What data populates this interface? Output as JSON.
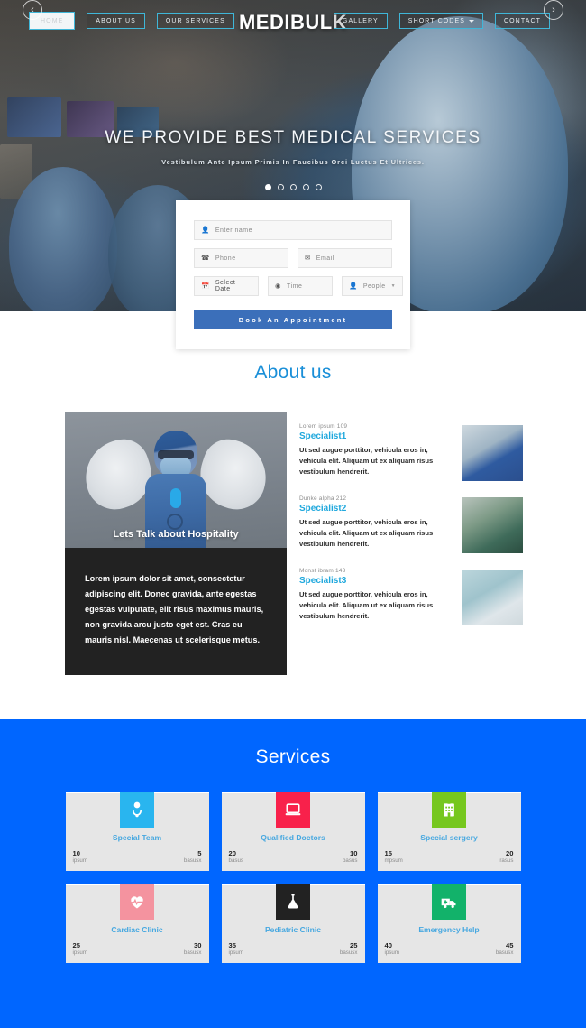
{
  "brand": "MEDIBULK",
  "nav": {
    "left": [
      {
        "label": "HOME",
        "active": true,
        "caret": false
      },
      {
        "label": "ABOUT US",
        "active": false,
        "caret": false
      },
      {
        "label": "OUR SERVICES",
        "active": false,
        "caret": false
      }
    ],
    "right": [
      {
        "label": "GALLERY",
        "active": false,
        "caret": false
      },
      {
        "label": "SHORT CODES",
        "active": false,
        "caret": true
      },
      {
        "label": "CONTACT",
        "active": false,
        "caret": false
      }
    ],
    "prev_icon": "chevron-left-icon",
    "next_icon": "chevron-right-icon"
  },
  "hero": {
    "title": "WE PROVIDE BEST MEDICAL SERVICES",
    "subtitle": "Vestibulum Ante Ipsum Primis In Faucibus Orci Luctus Et Ultrices.",
    "slides": 5,
    "active_slide": 1
  },
  "booking": {
    "name": {
      "placeholder": "Enter name",
      "value": "",
      "icon": "user-icon"
    },
    "phone": {
      "placeholder": "Phone",
      "value": "",
      "icon": "phone-icon"
    },
    "email": {
      "placeholder": "Email",
      "value": "",
      "icon": "envelope-icon"
    },
    "date": {
      "label": "Select Date",
      "icon": "calendar-icon"
    },
    "time": {
      "placeholder": "Time",
      "icon": "clock-icon"
    },
    "people": {
      "label": "People",
      "icon": "user-icon",
      "caret": "caret-down-icon"
    },
    "submit_label": "Book An Appointment",
    "submit_color": "#3b6fba"
  },
  "about": {
    "title": "About us",
    "card": {
      "image_caption": "Lets Talk about Hospitality",
      "body": "Lorem ipsum dolor sit amet, consectetur adipiscing elit. Donec gravida, ante egestas egestas vulputate, elit risus maximus mauris, non gravida arcu justo eget est. Cras eu mauris nisl. Maecenas ut scelerisque metus."
    },
    "specialists": [
      {
        "meta": "Lorem ipsum 109",
        "name": "Specialist1",
        "desc": "Ut sed augue porttitor, vehicula eros in, vehicula elit. Aliquam ut ex aliquam risus vestibulum hendrerit.",
        "thumb": "doctor-standing-photo"
      },
      {
        "meta": "Dunke alpha 212",
        "name": "Specialist2",
        "desc": "Ut sed augue porttitor, vehicula eros in, vehicula elit. Aliquam ut ex aliquam risus vestibulum hendrerit.",
        "thumb": "surgery-team-photo"
      },
      {
        "meta": "Monst ibram 143",
        "name": "Specialist3",
        "desc": "Ut sed augue porttitor, vehicula eros in, vehicula elit. Aliquam ut ex aliquam risus vestibulum hendrerit.",
        "thumb": "nurse-photo"
      }
    ],
    "accent_color": "#1fa8dd"
  },
  "services": {
    "title": "Services",
    "background_color": "#0066ff",
    "label_color": "#47a8e0",
    "items": [
      {
        "name": "Special Team",
        "icon": "doctor-stethoscope-icon",
        "icon_bg": "#29b5ef",
        "left_num": "10",
        "left_lbl": "ipsum",
        "right_num": "5",
        "right_lbl": "basusx"
      },
      {
        "name": "Qualified Doctors",
        "icon": "laptop-icon",
        "icon_bg": "#f8214b",
        "left_num": "20",
        "left_lbl": "basus",
        "right_num": "10",
        "right_lbl": "basus"
      },
      {
        "name": "Special sergery",
        "icon": "hospital-icon",
        "icon_bg": "#76c71e",
        "left_num": "15",
        "left_lbl": "mpsum",
        "right_num": "20",
        "right_lbl": "rasus"
      },
      {
        "name": "Cardiac Clinic",
        "icon": "heart-pulse-icon",
        "icon_bg": "#f4939f",
        "left_num": "25",
        "left_lbl": "ipsum",
        "right_num": "30",
        "right_lbl": "basusx"
      },
      {
        "name": "Pediatric Clinic",
        "icon": "flask-icon",
        "icon_bg": "#222222",
        "left_num": "35",
        "left_lbl": "ipsum",
        "right_num": "25",
        "right_lbl": "basusx"
      },
      {
        "name": "Emergency Help",
        "icon": "ambulance-icon",
        "icon_bg": "#12b26a",
        "left_num": "40",
        "left_lbl": "ipsum",
        "right_num": "45",
        "right_lbl": "basusx"
      }
    ]
  }
}
